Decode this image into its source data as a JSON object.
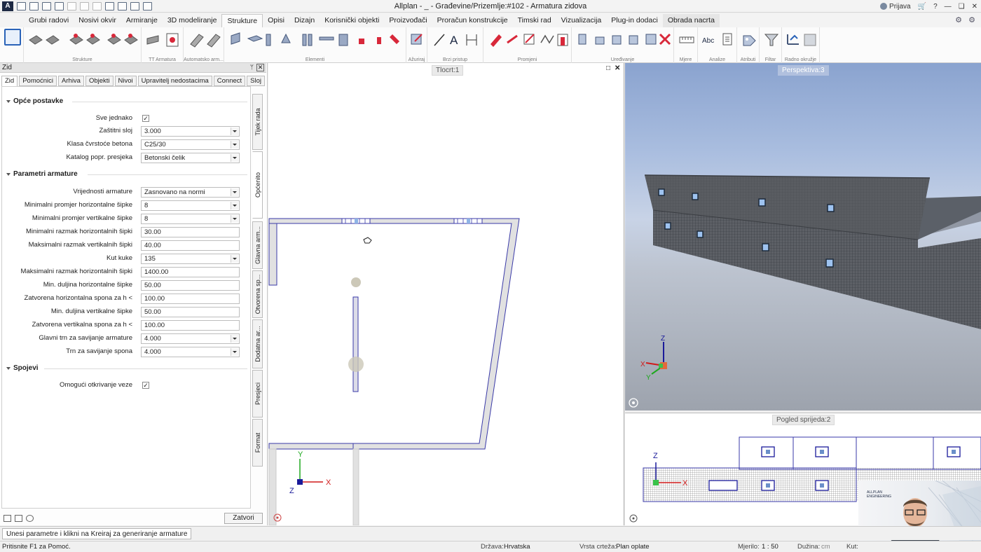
{
  "titlebar": {
    "app_letter": "A",
    "title": "Allplan - _ - Građevine/Prizemlje:#102 - Armatura zidova",
    "user_label": "Prijava",
    "help_icon": "?"
  },
  "menu": {
    "tabs": [
      "Grubi radovi",
      "Nosivi okvir",
      "Armiranje",
      "3D modeliranje",
      "Strukture",
      "Opisi",
      "Dizajn",
      "Korisnički objekti",
      "Proizvođači",
      "Proračun konstrukcije",
      "Timski rad",
      "Vizualizacija",
      "Plug-in dodaci",
      "Obrada nacrta"
    ],
    "active_tab": "Strukture"
  },
  "ribbon": {
    "groups": [
      "Strukture",
      "TT Armatura",
      "Automatsko arm...",
      "Elementi",
      "Ažuriraj",
      "Brzi pristup",
      "Promjeni",
      "Uređivanje",
      "Mjere",
      "Analize",
      "Atributi",
      "Filtar",
      "Radno okružje"
    ],
    "text_icon_A": "A",
    "text_icon_abc": "Abc"
  },
  "palette": {
    "title": "Zid",
    "pin": "ᛘ",
    "close": "✕",
    "tabs": [
      "Zid",
      "Pomoćnici",
      "Arhiva",
      "Objekti",
      "Nivoi",
      "Upravitelj nedostacima",
      "Connect",
      "Sloj"
    ],
    "side_tabs": [
      "Tijek rada",
      "Općenito",
      "Glavna arm...",
      "Otvorena sp...",
      "Dodatna ar...",
      "Presjeci",
      "Format"
    ],
    "sections": {
      "opce": "Opće postavke",
      "parametri": "Parametri armature",
      "spojevi": "Spojevi"
    },
    "fields": [
      {
        "label": "Sve jednako",
        "type": "check",
        "value": "✓"
      },
      {
        "label": "Zaštitni sloj",
        "type": "drop",
        "value": "3.000"
      },
      {
        "label": "Klasa čvrstoće betona",
        "type": "drop",
        "value": "C25/30"
      },
      {
        "label": "Katalog popr. presjeka",
        "type": "drop",
        "value": "Betonski čelik"
      },
      {
        "label": "Vrijednosti armature",
        "type": "drop",
        "value": "Zasnovano na normi"
      },
      {
        "label": "Minimalni promjer horizontalne šipke",
        "type": "drop",
        "value": "8"
      },
      {
        "label": "Minimalni promjer vertikalne šipke",
        "type": "drop",
        "value": "8"
      },
      {
        "label": "Minimalni razmak horizontalnih šipki",
        "type": "text",
        "value": "30.00"
      },
      {
        "label": "Maksimalni razmak vertikalnih šipki",
        "type": "text",
        "value": "40.00"
      },
      {
        "label": "Kut kuke",
        "type": "drop",
        "value": "135"
      },
      {
        "label": "Maksimalni razmak horizontalnih šipki",
        "type": "text",
        "value": "1400.00"
      },
      {
        "label": "Min. duljina horizontalne šipke",
        "type": "text",
        "value": "50.00"
      },
      {
        "label": "Zatvorena horizontalna spona za h <",
        "type": "text",
        "value": "100.00"
      },
      {
        "label": "Min. duljina vertikalne šipke",
        "type": "text",
        "value": "50.00"
      },
      {
        "label": "Zatvorena vertikalna spona za h <",
        "type": "text",
        "value": "100.00"
      },
      {
        "label": "Glavni trn za savijanje armature",
        "type": "drop",
        "value": "4.000"
      },
      {
        "label": "Trn za savijanje spona",
        "type": "drop",
        "value": "4.000"
      },
      {
        "label": "Omogući otkrivanje veze",
        "type": "check",
        "value": "✓"
      }
    ],
    "close_button": "Zatvori"
  },
  "views": {
    "tlocrt": {
      "label": "Tlocrt:1",
      "max_icon": "□",
      "close_icon": "✕"
    },
    "perspektiva": {
      "label": "Perspektiva:3"
    },
    "front": {
      "label": "Pogled sprijeda:2"
    },
    "axes": {
      "x": "X",
      "y": "Y",
      "z": "Z"
    }
  },
  "webcam": {
    "logo_line1": "ALLPLAN",
    "logo_line2": "ENGINEERING"
  },
  "command": {
    "prompt": "Unesi parametre i klikni na Kreiraj za generiranje armature"
  },
  "statusbar": {
    "help": "Pritisnite F1 za Pomoć.",
    "country_label": "Država:",
    "country": "Hrvatska",
    "drawing_type_label": "Vrsta crteža:",
    "drawing_type": "Plan oplate",
    "scale_label": "Mjerilo:",
    "scale": "1 : 50",
    "length_label": "Dužina:",
    "length_unit": "cm",
    "angle_label": "Kut:"
  },
  "colors": {
    "accent": "#2a63b8",
    "wall_outline": "#3a3aa8",
    "axis_x": "#d11a1a",
    "axis_y": "#1fa81f",
    "axis_z": "#1a1a9a"
  }
}
